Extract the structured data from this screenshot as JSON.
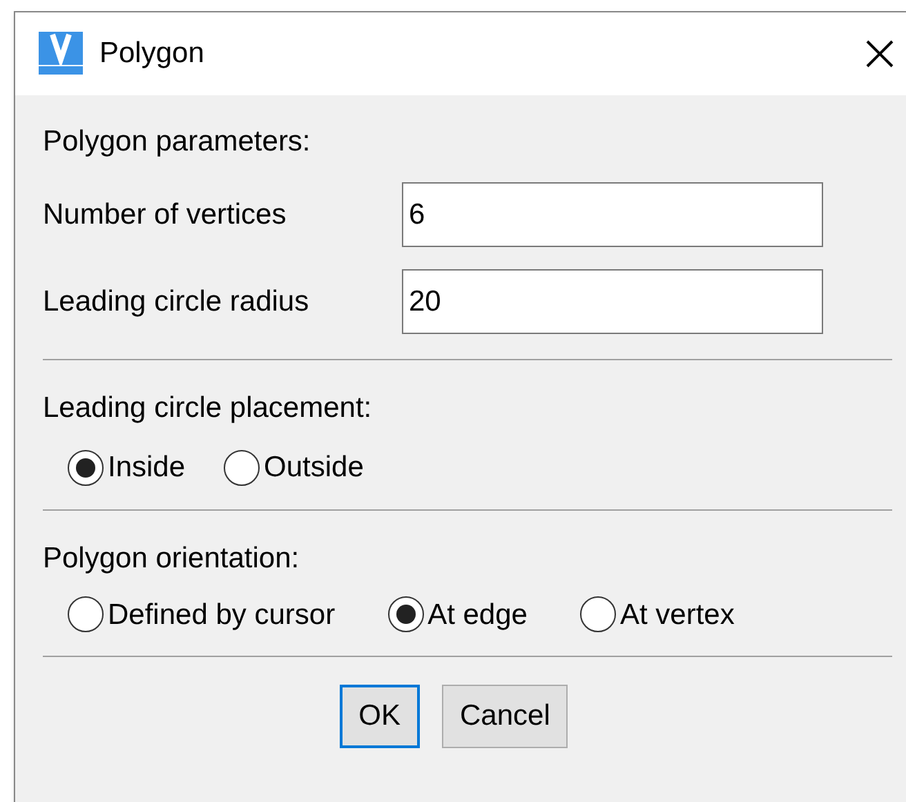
{
  "window": {
    "title": "Polygon"
  },
  "parameters": {
    "heading": "Polygon parameters:",
    "fields": [
      {
        "label": "Number of vertices",
        "value": "6"
      },
      {
        "label": "Leading circle radius",
        "value": "20"
      }
    ]
  },
  "placement": {
    "heading": "Leading circle placement:",
    "options": [
      {
        "label": "Inside",
        "selected": true
      },
      {
        "label": "Outside",
        "selected": false
      }
    ]
  },
  "orientation": {
    "heading": "Polygon orientation:",
    "options": [
      {
        "label": "Defined by cursor",
        "selected": false
      },
      {
        "label": "At edge",
        "selected": true
      },
      {
        "label": "At vertex",
        "selected": false
      }
    ]
  },
  "buttons": [
    {
      "label": "OK",
      "default": true
    },
    {
      "label": "Cancel",
      "default": false
    }
  ]
}
